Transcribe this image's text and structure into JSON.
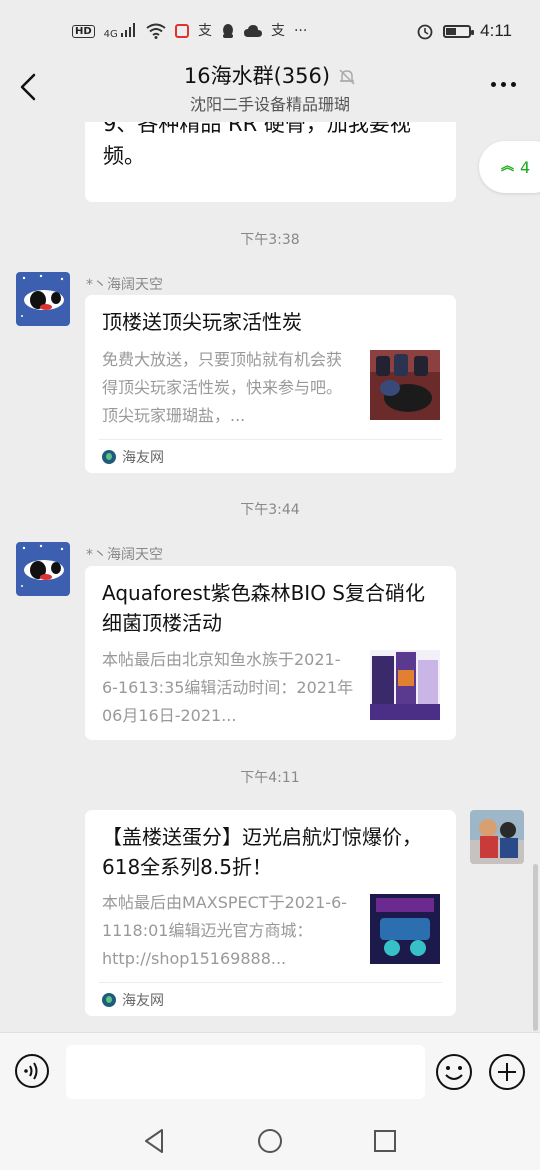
{
  "status_bar": {
    "hd": "HD",
    "signal": "4G",
    "time": "4:11",
    "battery_level": 0.5
  },
  "header": {
    "title": "16海水群(356)",
    "subtitle": "沈阳二手设备精品珊瑚"
  },
  "jump_to_new": {
    "count": "4"
  },
  "messages": [
    {
      "text": "9、各种精品 RR 硬骨，加我要视频。"
    },
    {
      "time": "下午3:38"
    },
    {
      "sender": "*丶海阔天空",
      "card": {
        "title": "顶楼送顶尖玩家活性炭",
        "desc": "免费大放送，只要顶帖就有机会获得顶尖玩家活性炭，快来参与吧。顶尖玩家珊瑚盐，...",
        "source": "海友网"
      }
    },
    {
      "time": "下午3:44"
    },
    {
      "sender": "*丶海阔天空",
      "card": {
        "title": "Aquaforest紫色森林BIO S复合硝化细菌顶楼活动",
        "desc": "本帖最后由北京知鱼水族于2021-6-1613:35编辑活动时间：2021年06月16日-2021..."
      }
    },
    {
      "time": "下午4:11"
    },
    {
      "self": true,
      "card": {
        "title": "【盖楼送蛋分】迈光启航灯惊爆价，618全系列8.5折！",
        "desc": "本帖最后由MAXSPECT于2021-6-1118:01编辑迈光官方商城：http://shop15169888...",
        "source": "海友网"
      }
    }
  ],
  "input_bar": {
    "placeholder": ""
  },
  "icons": {
    "voice": "voice-icon",
    "emoji": "emoji-icon",
    "plus": "plus-icon",
    "back": "back-icon",
    "more": "more-icon",
    "mute": "mute-bell-icon"
  },
  "colors": {
    "background": "#ededed",
    "accent_green": "#1aad19",
    "bubble": "#ffffff"
  }
}
